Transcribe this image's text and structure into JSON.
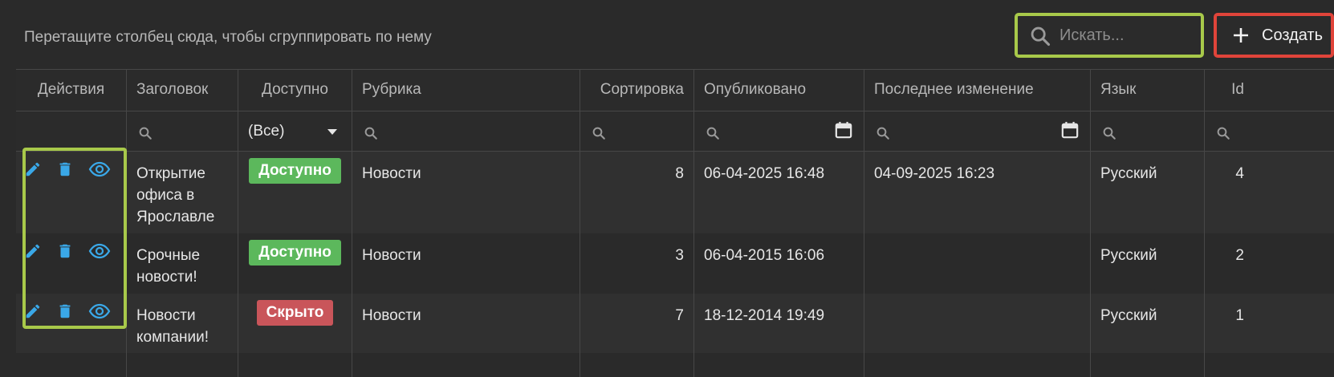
{
  "toolbar": {
    "group_hint": "Перетащите столбец сюда, чтобы сгруппировать по нему",
    "search_placeholder": "Искать...",
    "create_label": "Создать"
  },
  "columns": [
    {
      "label": "Действия"
    },
    {
      "label": "Заголовок"
    },
    {
      "label": "Доступно"
    },
    {
      "label": "Рубрика"
    },
    {
      "label": "Сортировка"
    },
    {
      "label": "Опубликовано"
    },
    {
      "label": "Последнее изменение"
    },
    {
      "label": "Язык"
    },
    {
      "label": "Id"
    }
  ],
  "filters": {
    "available_value": "(Все)"
  },
  "rows": [
    {
      "title": "Открытие офиса в Ярославле",
      "status": "Доступно",
      "rubric": "Новости",
      "sort": "8",
      "published": "06-04-2025 16:48",
      "modified": "04-09-2025 16:23",
      "language": "Русский",
      "id": "4"
    },
    {
      "title": "Срочные новости!",
      "status": "Доступно",
      "rubric": "Новости",
      "sort": "3",
      "published": "06-04-2015 16:06",
      "modified": "",
      "language": "Русский",
      "id": "2"
    },
    {
      "title": "Новости компании!",
      "status": "Скрыто",
      "rubric": "Новости",
      "sort": "7",
      "published": "18-12-2014 19:49",
      "modified": "",
      "language": "Русский",
      "id": "1"
    }
  ],
  "colors": {
    "accent_icon": "#3aa8e8",
    "available": "#5cb85c",
    "hidden": "#c9555a",
    "highlight_green": "#a8c94a",
    "highlight_red": "#e0443a"
  },
  "icons": [
    "search-icon",
    "plus-icon",
    "calendar-icon",
    "pencil-icon",
    "trash-icon",
    "eye-icon"
  ]
}
